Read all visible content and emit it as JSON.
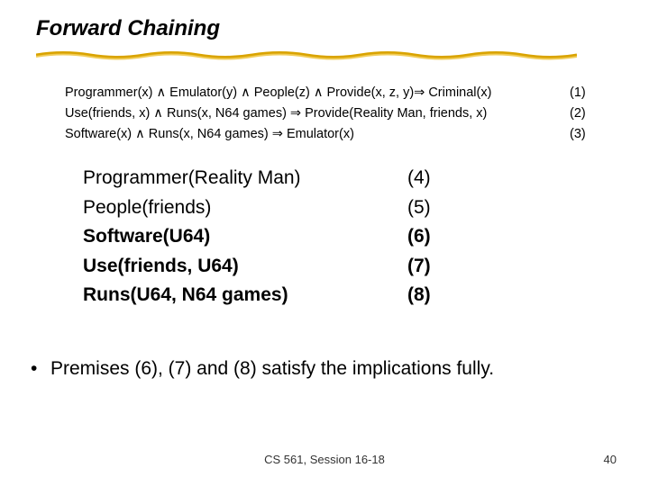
{
  "title": "Forward Chaining",
  "rules": [
    {
      "text": "Programmer(x) ∧ Emulator(y) ∧ People(z) ∧ Provide(x, z, y)⇒ Criminal(x)",
      "num": "(1)"
    },
    {
      "text": "Use(friends, x) ∧ Runs(x, N64 games) ⇒ Provide(Reality Man, friends, x)",
      "num": "(2)"
    },
    {
      "text": "Software(x) ∧ Runs(x, N64 games) ⇒ Emulator(x)",
      "num": "(3)"
    }
  ],
  "facts": [
    {
      "text": "Programmer(Reality Man)",
      "num": "(4)",
      "bold": false
    },
    {
      "text": "People(friends)",
      "num": "(5)",
      "bold": false
    },
    {
      "text": "Software(U64)",
      "num": "(6)",
      "bold": true
    },
    {
      "text": "Use(friends, U64)",
      "num": "(7)",
      "bold": true
    },
    {
      "text": "Runs(U64, N64 games)",
      "num": "(8)",
      "bold": true
    }
  ],
  "bullet": "Premises (6), (7) and (8) satisfy the implications fully.",
  "footer_center": "CS 561,  Session 16-18",
  "footer_right": "40"
}
